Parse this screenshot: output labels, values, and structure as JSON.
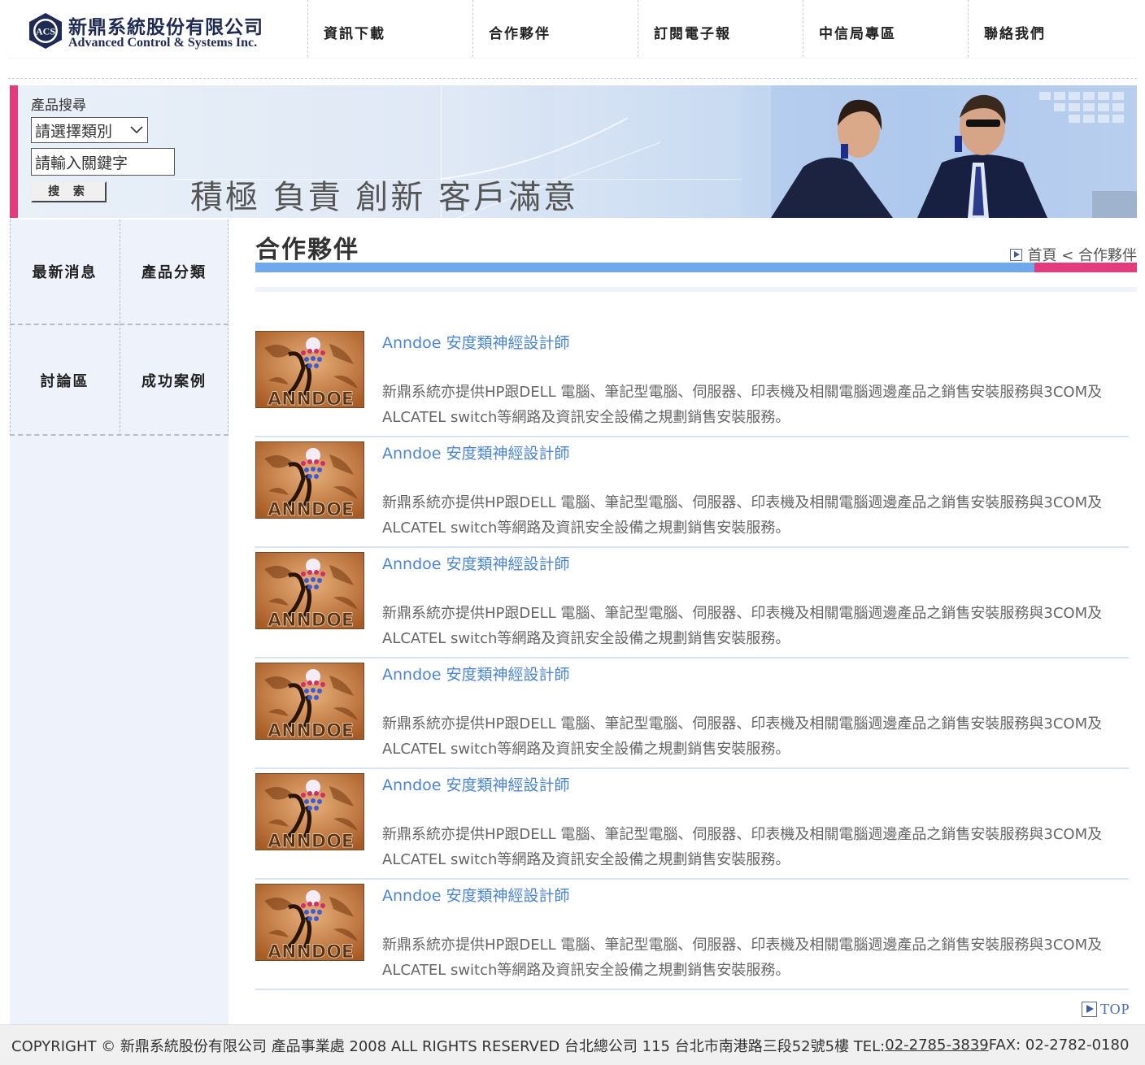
{
  "header": {
    "logo": {
      "emblem_text": "ACS",
      "name_cn": "新鼎系統股份有限公司",
      "name_en": "Advanced Control & Systems Inc."
    },
    "nav": [
      {
        "label": "資訊下載"
      },
      {
        "label": "合作夥伴"
      },
      {
        "label": "訂閱電子報"
      },
      {
        "label": "中信局專區"
      },
      {
        "label": "聯絡我們"
      }
    ]
  },
  "search": {
    "label": "產品搜尋",
    "category_selected": "請選擇類別",
    "keyword_value": "請輸入關鍵字",
    "button_label": "搜 索"
  },
  "banner": {
    "slogan": "積極 負責 創新 客戶滿意"
  },
  "sidebar": {
    "items": [
      {
        "label": "最新消息"
      },
      {
        "label": "產品分類"
      },
      {
        "label": "討論區"
      },
      {
        "label": "成功案例"
      }
    ]
  },
  "main": {
    "title": "合作夥伴",
    "breadcrumb": "首頁 < 合作夥伴",
    "thumb_text": "ANNDOE",
    "partners": [
      {
        "title": "Anndoe 安度類神經設計師",
        "desc": "新鼎系統亦提供HP跟DELL 電腦、筆記型電腦、伺服器、印表機及相關電腦週邊產品之銷售安裝服務與3COM及ALCATEL switch等網路及資訊安全設備之規劃銷售安裝服務。"
      },
      {
        "title": "Anndoe 安度類神經設計師",
        "desc": "新鼎系統亦提供HP跟DELL 電腦、筆記型電腦、伺服器、印表機及相關電腦週邊產品之銷售安裝服務與3COM及ALCATEL switch等網路及資訊安全設備之規劃銷售安裝服務。"
      },
      {
        "title": "Anndoe 安度類神經設計師",
        "desc": "新鼎系統亦提供HP跟DELL 電腦、筆記型電腦、伺服器、印表機及相關電腦週邊產品之銷售安裝服務與3COM及ALCATEL switch等網路及資訊安全設備之規劃銷售安裝服務。"
      },
      {
        "title": "Anndoe 安度類神經設計師",
        "desc": "新鼎系統亦提供HP跟DELL 電腦、筆記型電腦、伺服器、印表機及相關電腦週邊產品之銷售安裝服務與3COM及ALCATEL switch等網路及資訊安全設備之規劃銷售安裝服務。"
      },
      {
        "title": "Anndoe 安度類神經設計師",
        "desc": "新鼎系統亦提供HP跟DELL 電腦、筆記型電腦、伺服器、印表機及相關電腦週邊產品之銷售安裝服務與3COM及ALCATEL switch等網路及資訊安全設備之規劃銷售安裝服務。"
      },
      {
        "title": "Anndoe 安度類神經設計師",
        "desc": "新鼎系統亦提供HP跟DELL 電腦、筆記型電腦、伺服器、印表機及相關電腦週邊產品之銷售安裝服務與3COM及ALCATEL switch等網路及資訊安全設備之規劃銷售安裝服務。"
      }
    ],
    "top_link": "TOP"
  },
  "footer": {
    "copyright": "COPYRIGHT © 新鼎系統股份有限公司 產品事業處 2008 ALL RIGHTS RESERVED 台北總公司 115 台北市南港路三段52號5樓 TEL: ",
    "tel": "02-2785-3839",
    "fax": " FAX: 02-2782-0180"
  },
  "colors": {
    "accent_blue": "#6fa8ec",
    "accent_pink": "#e33b7b",
    "link_blue": "#4a84d6"
  }
}
